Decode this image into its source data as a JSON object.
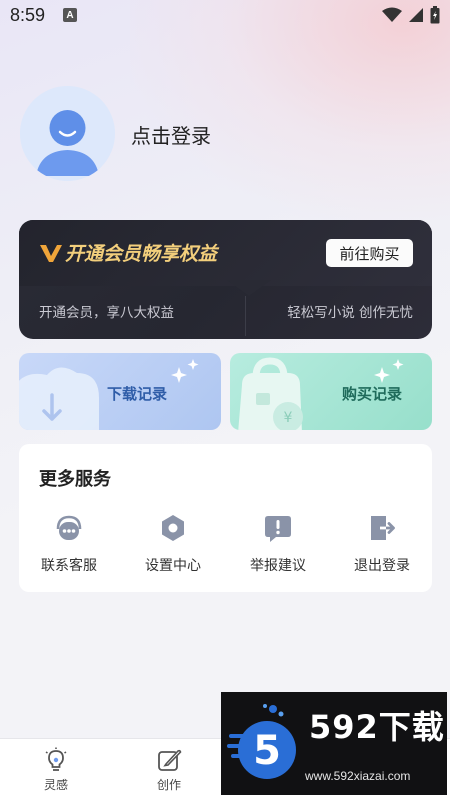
{
  "status_bar": {
    "time": "8:59",
    "a_badge": "A"
  },
  "profile": {
    "login_label": "点击登录"
  },
  "vip": {
    "title": "开通会员畅享权益",
    "button_label": "前往购买",
    "subtitle_left": "开通会员，享八大权益",
    "subtitle_right": "轻松写小说 创作无忧",
    "accent_color": "#f3cf7c"
  },
  "records": {
    "download_label": "下载记录",
    "purchase_label": "购买记录"
  },
  "services": {
    "title": "更多服务",
    "items": [
      {
        "label": "联系客服",
        "icon": "headset-icon"
      },
      {
        "label": "设置中心",
        "icon": "gear-icon"
      },
      {
        "label": "举报建议",
        "icon": "report-icon"
      },
      {
        "label": "退出登录",
        "icon": "logout-icon"
      }
    ]
  },
  "bottom_nav": {
    "items": [
      {
        "label": "灵感",
        "icon": "lightbulb-icon"
      },
      {
        "label": "创作",
        "icon": "edit-icon"
      }
    ]
  },
  "watermark": {
    "brand": "592下载",
    "url": "www.592xiazai.com"
  }
}
